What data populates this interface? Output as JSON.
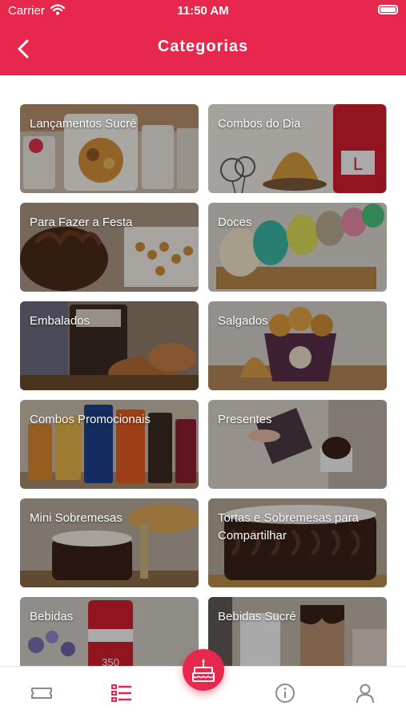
{
  "status_bar": {
    "carrier": "Carrier",
    "time": "11:50 AM",
    "wifi_icon": "wifi-icon",
    "battery_icon": "battery-icon"
  },
  "header": {
    "title": "Categorias",
    "back_icon": "chevron-left-icon",
    "background_color": "#e8274d"
  },
  "categories": [
    {
      "label": "Lançamentos Sucré",
      "image": "sucre-candy-packages"
    },
    {
      "label": "Combos do Dia",
      "image": "coxinha-and-coca-cola-combo"
    },
    {
      "label": "Para Fazer a Festa",
      "image": "chocolate-cake-and-party-sweets"
    },
    {
      "label": "Doces",
      "image": "colorful-macarons"
    },
    {
      "label": "Embalados",
      "image": "packaged-snacks"
    },
    {
      "label": "Salgados",
      "image": "fried-savory-snacks"
    },
    {
      "label": "Combos Promocionais",
      "image": "promotional-snack-packs"
    },
    {
      "label": "Presentes",
      "image": "gift-chocolate-box"
    },
    {
      "label": "Mini Sobremesas",
      "image": "mini-chocolate-dessert"
    },
    {
      "label": "Tortas e Sobremesas para Compartilhar",
      "image": "chocolate-layer-cake"
    },
    {
      "label": "Bebidas",
      "image": "coca-cola-can"
    },
    {
      "label": "Bebidas Sucré",
      "image": "chocolate-drinks"
    }
  ],
  "tab_bar": {
    "tabs": [
      {
        "name": "ticket-icon",
        "active": false
      },
      {
        "name": "list-icon",
        "active": true
      },
      {
        "name": "birthday-cake-icon",
        "active": false
      },
      {
        "name": "info-icon",
        "active": false
      },
      {
        "name": "user-icon",
        "active": false
      }
    ],
    "active_color": "#e8274d",
    "inactive_color": "#8a8a8a"
  }
}
